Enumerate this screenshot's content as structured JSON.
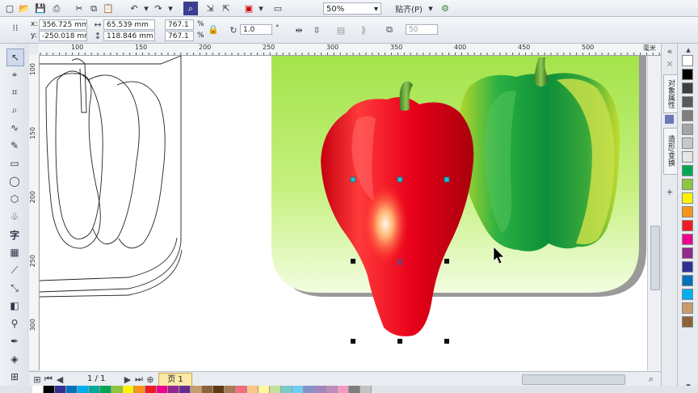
{
  "toolbar": {
    "zoom_value": "50%",
    "snap_label": "贴齐(P)"
  },
  "property_bar": {
    "x_label": "x:",
    "x_value": "356.725 mm",
    "y_label": "y:",
    "y_value": "-250.018 mm",
    "width_value": "65.539 mm",
    "height_value": "118.846 mm",
    "scale_x": "767.1",
    "scale_y": "767.1",
    "percent": "%",
    "rotation_value": "1.0",
    "degree": "°",
    "outline_value": "50"
  },
  "ruler": {
    "h_ticks": [
      "100",
      "150",
      "200",
      "250",
      "300",
      "350",
      "400",
      "450",
      "500"
    ],
    "v_ticks": [
      "100",
      "150",
      "200",
      "250",
      "300"
    ],
    "unit": "毫米"
  },
  "status": {
    "page_count": "1 / 1",
    "page_tab": "页 1"
  },
  "dockers": {
    "tab1": "对象属性",
    "tab2": "造形/变换"
  },
  "colors": {
    "accent_blue": "#2a61b7",
    "selection_node": "#2fb8c8"
  },
  "palette_colors": [
    "#ffffff",
    "#000000",
    "#3f3f3f",
    "#595959",
    "#7f7f7f",
    "#a5a5a5",
    "#c8c8c8",
    "#e6e6e6",
    "#00a651",
    "#8dc63f",
    "#fff200",
    "#f7941d",
    "#ed1c24",
    "#ec008c",
    "#92278f",
    "#2e3192",
    "#0072bc",
    "#00aeef",
    "#c69c6d",
    "#8c6239"
  ],
  "bottom_palette": [
    "#ffffff",
    "#000000",
    "#2e3192",
    "#0072bc",
    "#00aeef",
    "#00a99d",
    "#00a651",
    "#8dc63f",
    "#fff200",
    "#f7941d",
    "#ed1c24",
    "#ec008c",
    "#92278f",
    "#662d91",
    "#c69c6d",
    "#8c6239",
    "#603913",
    "#a67c52",
    "#f26d7d",
    "#fdc689",
    "#fff799",
    "#c4df9b",
    "#7accc8",
    "#6dcff6",
    "#8393ca",
    "#a186be",
    "#bd8cbf",
    "#f49ac1",
    "#7d7d7d",
    "#c2c2c2"
  ]
}
